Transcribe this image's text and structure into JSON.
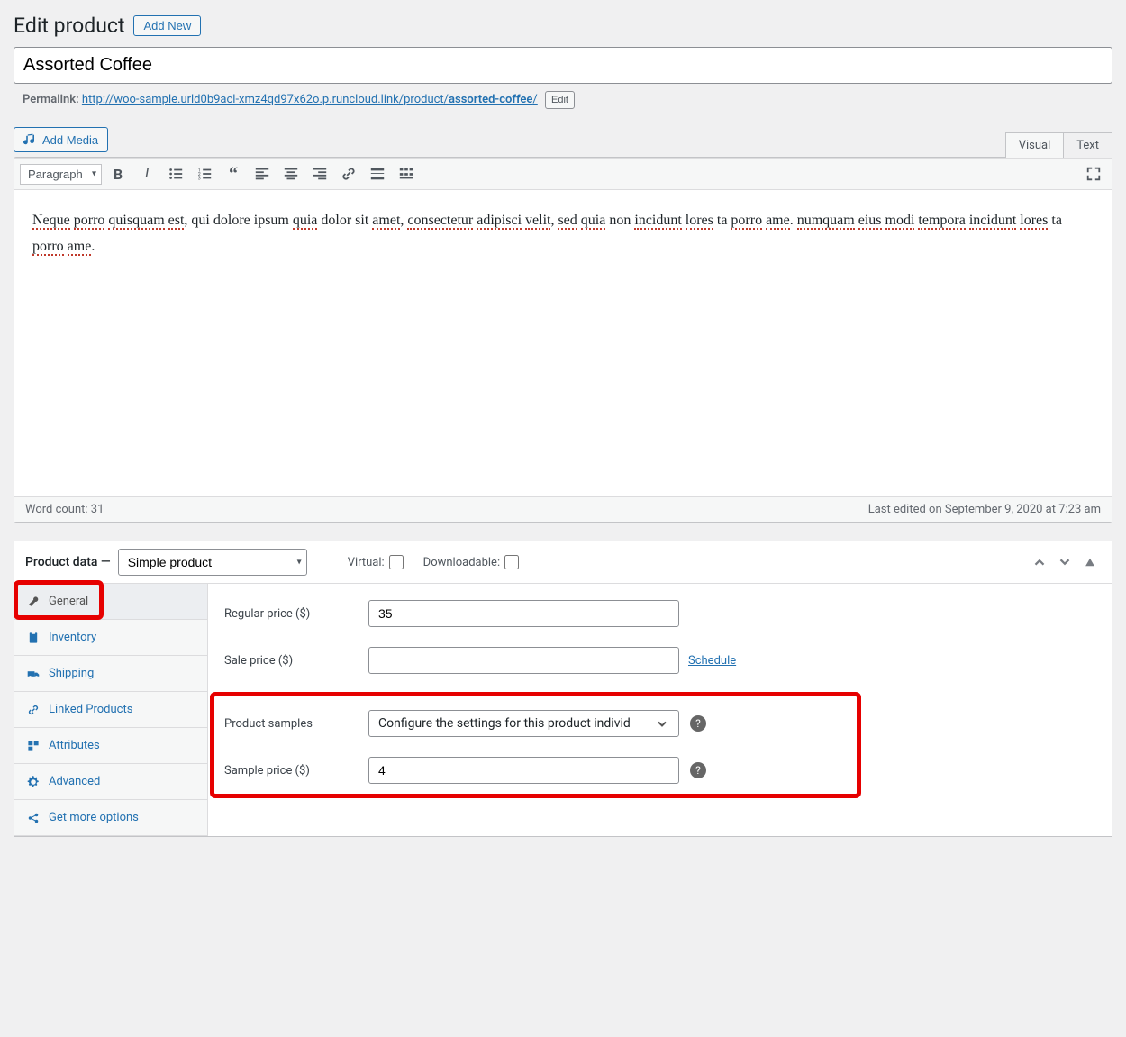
{
  "header": {
    "title": "Edit product",
    "add_new": "Add New"
  },
  "product_title": "Assorted Coffee",
  "permalink": {
    "label": "Permalink:",
    "url_base": "http://woo-sample.urld0b9acl-xmz4qd97x62o.p.runcloud.link/product/",
    "slug": "assorted-coffee",
    "edit_label": "Edit"
  },
  "editor": {
    "add_media": "Add Media",
    "tabs": {
      "visual": "Visual",
      "text": "Text"
    },
    "format_selected": "Paragraph",
    "content": "Neque porro quisquam est, qui dolore ipsum quia dolor sit amet, consectetur adipisci velit, sed quia non incidunt lores ta porro ame. numquam eius modi tempora incidunt lores ta porro ame.",
    "word_count_label": "Word count: 31",
    "last_edited": "Last edited on September 9, 2020 at 7:23 am"
  },
  "product_data": {
    "label": "Product data —",
    "type_selected": "Simple product",
    "virtual_label": "Virtual:",
    "downloadable_label": "Downloadable:",
    "tabs": {
      "general": "General",
      "inventory": "Inventory",
      "shipping": "Shipping",
      "linked": "Linked Products",
      "attributes": "Attributes",
      "advanced": "Advanced",
      "more": "Get more options"
    },
    "fields": {
      "regular_price_label": "Regular price ($)",
      "regular_price_value": "35",
      "sale_price_label": "Sale price ($)",
      "sale_price_value": "",
      "schedule_label": "Schedule",
      "product_samples_label": "Product samples",
      "product_samples_selected": "Configure the settings for this product individually",
      "sample_price_label": "Sample price ($)",
      "sample_price_value": "4"
    }
  }
}
